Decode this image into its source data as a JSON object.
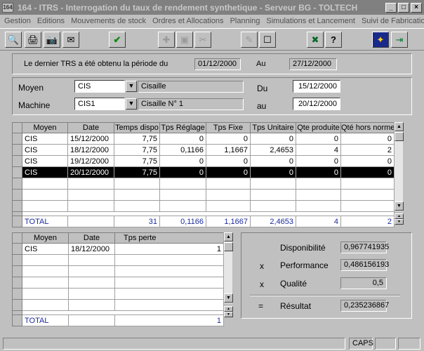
{
  "window": {
    "app_icon": "164",
    "title": "164 - ITRS - Interrogation du taux de rendement synthetique - Serveur BG - TOLTECH"
  },
  "menu": [
    "Gestion",
    "Editions",
    "Mouvements de stock",
    "Ordres et Allocations",
    "Planning",
    "Simulations et Lancement",
    "Suivi de Fabrication"
  ],
  "header": {
    "info_text": "Le dernier TRS a été obtenu la période du",
    "from_date": "01/12/2000",
    "to_label": "Au",
    "to_date": "27/12/2000"
  },
  "filters": {
    "moyen_label": "Moyen",
    "moyen_code": "CIS",
    "moyen_desc": "Cisaille",
    "machine_label": "Machine",
    "machine_code": "CIS1",
    "machine_desc": "Cisaille N° 1",
    "du_label": "Du",
    "du_date": "15/12/2000",
    "au_label": "au",
    "au_date": "20/12/2000"
  },
  "main_grid": {
    "columns": [
      "Moyen",
      "Date",
      "Temps dispo",
      "Tps Réglage",
      "Tps Fixe",
      "Tps Unitaire",
      "Qte produite",
      "Qté hors norme"
    ],
    "rows": [
      [
        "CIS",
        "15/12/2000",
        "7,75",
        "0",
        "0",
        "0",
        "0",
        "0"
      ],
      [
        "CIS",
        "18/12/2000",
        "7,75",
        "0,1166",
        "1,1667",
        "2,4653",
        "4",
        "2"
      ],
      [
        "CIS",
        "19/12/2000",
        "7,75",
        "0",
        "0",
        "0",
        "0",
        "0"
      ],
      [
        "CIS",
        "20/12/2000",
        "7,75",
        "0",
        "0",
        "0",
        "0",
        "0"
      ]
    ],
    "total": [
      "TOTAL",
      "",
      "31",
      "0,1166",
      "1,1667",
      "2,4653",
      "4",
      "2"
    ]
  },
  "perte_grid": {
    "columns": [
      "Moyen",
      "Date",
      "Tps perte"
    ],
    "rows": [
      [
        "CIS",
        "18/12/2000",
        "1"
      ]
    ],
    "total": [
      "TOTAL",
      "",
      "1"
    ]
  },
  "trs": {
    "disponibilite_label": "Disponibilité",
    "disponibilite_value": "0,967741935",
    "x1": "x",
    "performance_label": "Performance",
    "performance_value": "0,486156193",
    "x2": "x",
    "qualite_label": "Qualité",
    "qualite_value": "0,5",
    "eq": "=",
    "resultat_label": "Résultat",
    "resultat_value": "0,235236867"
  },
  "status": {
    "caps": "CAPS"
  },
  "icons": [
    "zoom-icon",
    "printer-icon",
    "camera-icon",
    "mail-icon",
    "ok-icon",
    "add-icon",
    "save-icon",
    "cut-icon",
    "edit-icon",
    "new-icon",
    "excel-icon",
    "help-icon",
    "wizard-icon",
    "exit-icon"
  ]
}
